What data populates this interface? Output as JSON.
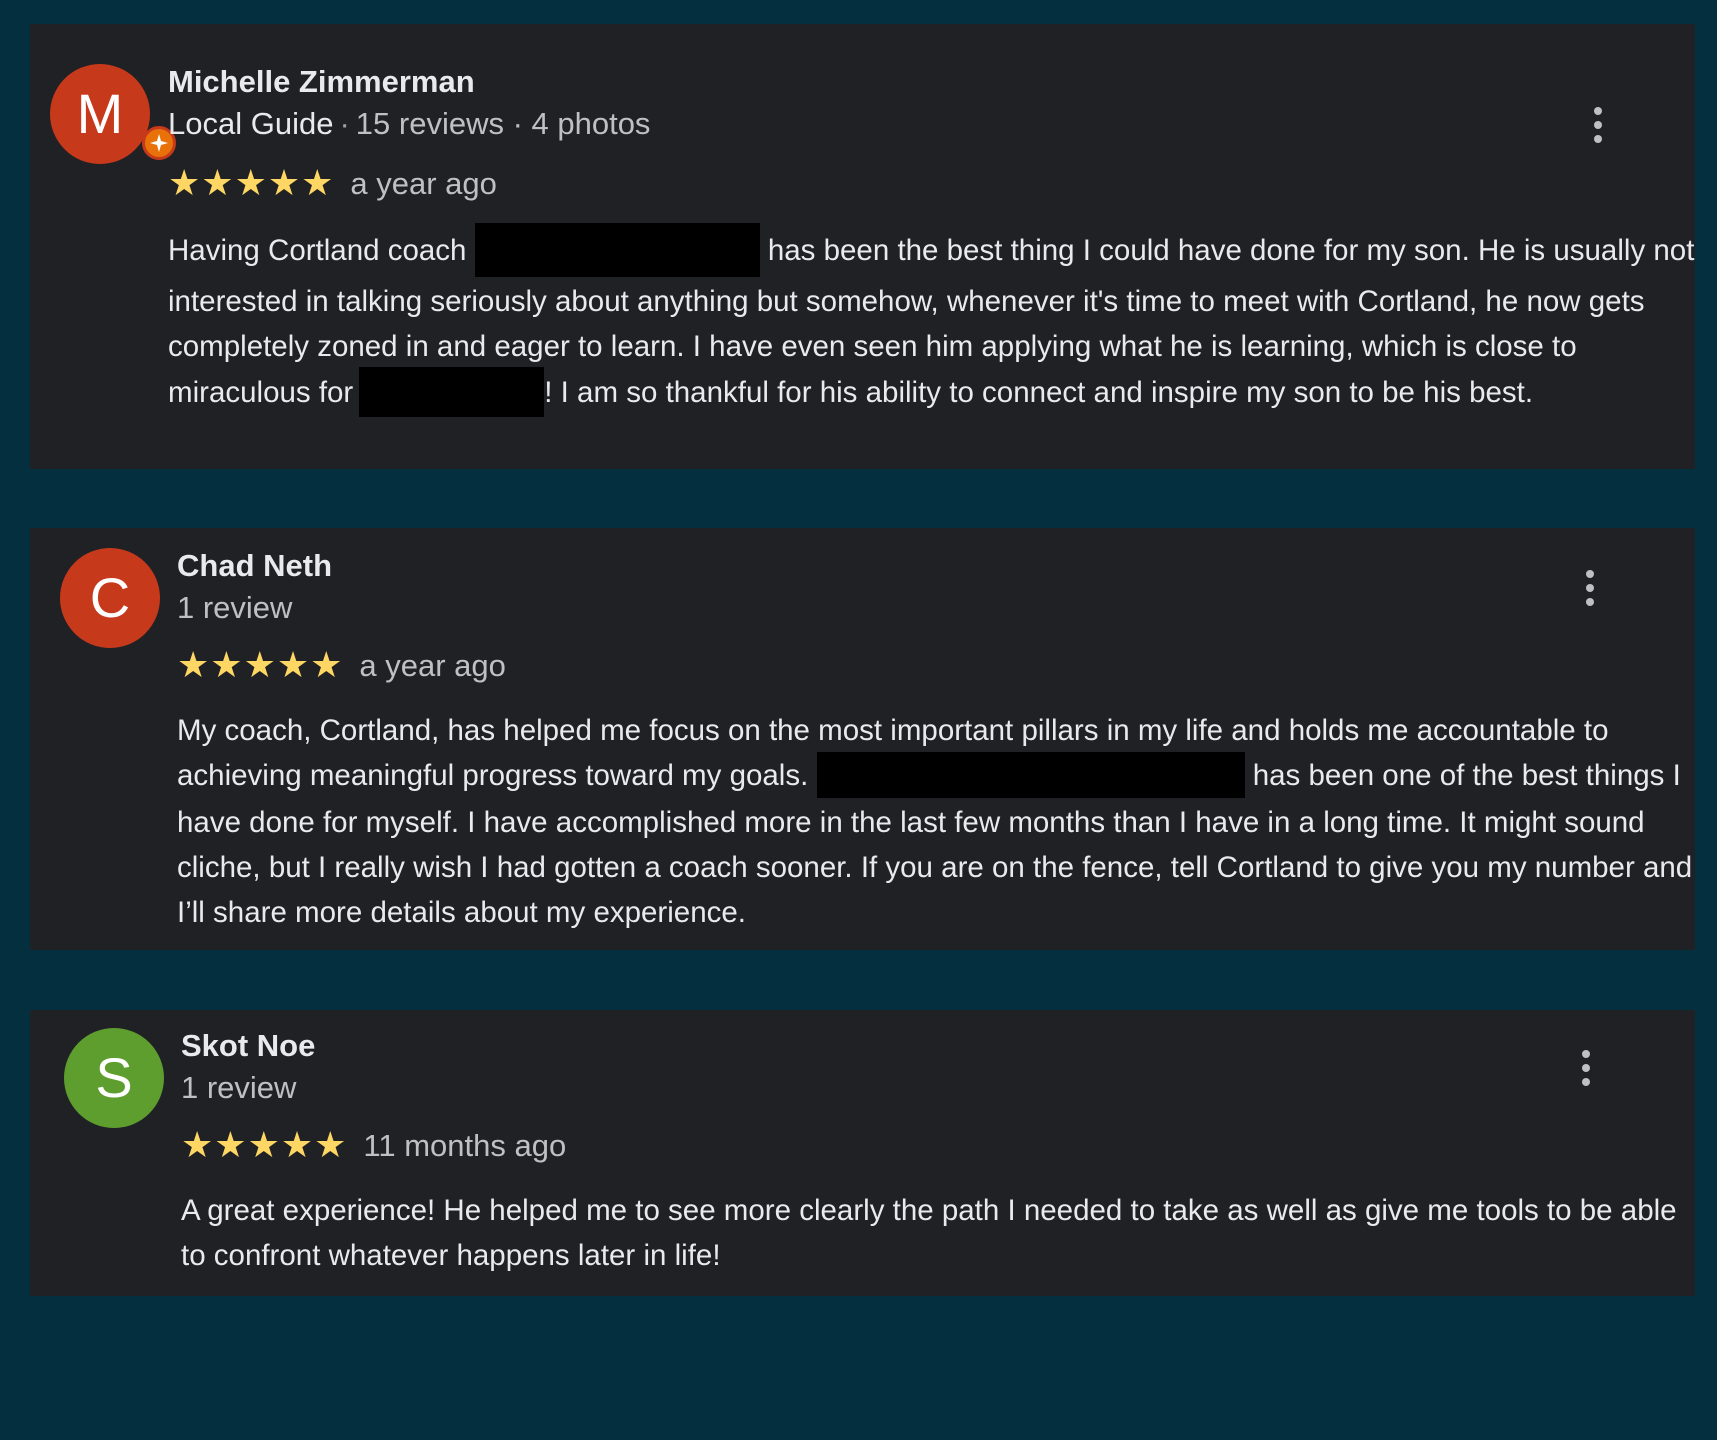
{
  "colors": {
    "page_background": "#032f3f",
    "card_background": "#202124",
    "star": "#fdd663",
    "text_primary": "#e8eaed",
    "text_secondary": "#bdc1c6"
  },
  "reviews": [
    {
      "avatar_letter": "M",
      "avatar_color": "#c7391b",
      "local_guide_badge_icon": "local-guide-star-icon",
      "name": "Michelle Zimmerman",
      "badge": "Local Guide",
      "stats": "15 reviews · 4 photos",
      "rating": 5,
      "date": "a year ago",
      "text": {
        "p1": "Having Cortland coach",
        "p2": "has been the best thing I could have done for my son. He is usually not interested in talking seriously about anything but somehow, whenever it's time to meet with Cortland, he now gets completely zoned in and eager to learn. I have even seen him applying what he is learning, which is close to miraculous for",
        "p3": "! I am so thankful for his ability to connect and inspire my son to be his best."
      },
      "more_icon": "more-vert-icon"
    },
    {
      "avatar_letter": "C",
      "avatar_color": "#c7391b",
      "name": "Chad Neth",
      "stats": "1 review",
      "rating": 5,
      "date": "a year ago",
      "text": {
        "p1": "My coach, Cortland, has helped me focus on the most important pillars in my life and holds me accountable to achieving meaningful progress toward my goals.",
        "p2": "has been one of the best things I have done for myself. I have accomplished more in the last few months than I have in a long time. It might sound cliche, but I really wish I had gotten a coach sooner. If you are on the fence, tell Cortland to give you my number and I’ll share more details about my experience."
      },
      "more_icon": "more-vert-icon"
    },
    {
      "avatar_letter": "S",
      "avatar_color": "#5e9e2f",
      "name": "Skot Noe",
      "stats": "1 review",
      "rating": 5,
      "date": "11 months ago",
      "text": {
        "p1": "A great experience! He helped me to see more clearly the path I needed to take as well as give me tools to be able to confront whatever happens later in life!"
      },
      "more_icon": "more-vert-icon"
    }
  ]
}
